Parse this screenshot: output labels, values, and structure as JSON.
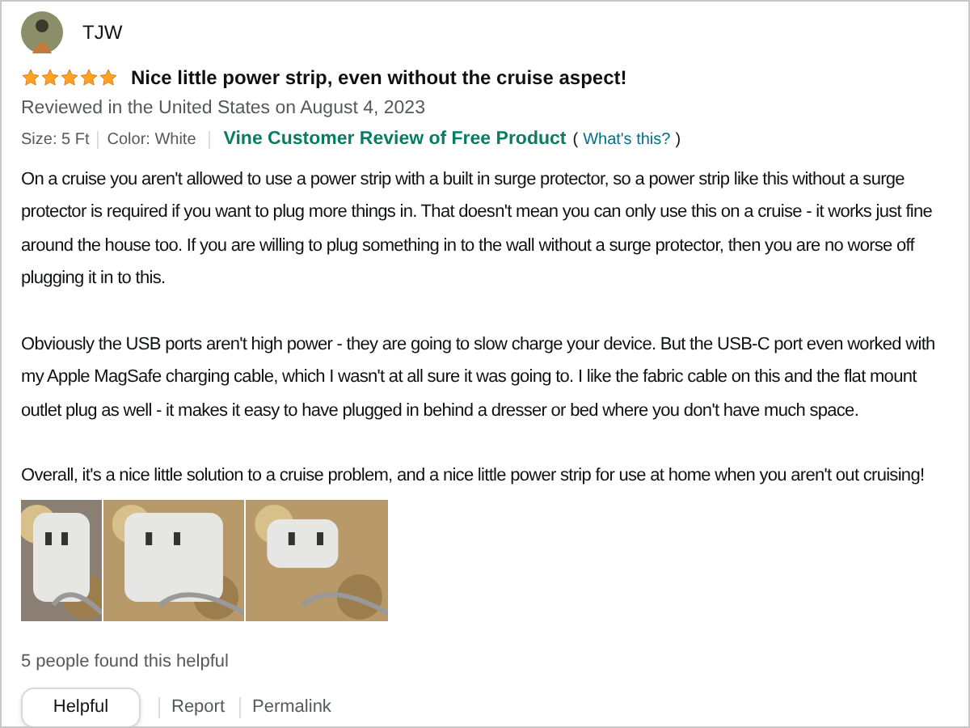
{
  "reviewer": {
    "name": "TJW"
  },
  "review": {
    "stars": 5,
    "title": "Nice little power strip, even without the cruise aspect!",
    "location_date": "Reviewed in the United States on August 4, 2023",
    "attributes": [
      "Size: 5 Ft",
      "Color: White"
    ],
    "vine_badge": "Vine Customer Review of Free Product",
    "whats_this_open": "(",
    "whats_this": "What's this?",
    "whats_this_close": ")",
    "paragraphs": [
      "On a cruise you aren't allowed to use a power strip with a built in surge protector, so a power strip like this without a surge protector is required if you want to plug more things in. That doesn't mean you can only use this on a cruise - it works just fine around the house too. If you are willing to plug something in to the wall without a surge protector, then you are no worse off plugging it in to this.",
      "Obviously the USB ports aren't high power - they are going to slow charge your device. But the USB-C port even worked with my Apple MagSafe charging cable, which I wasn't at all sure it was going to. I like the fabric cable on this and the flat mount outlet plug as well - it makes it easy to have plugged in behind a dresser or bed where you don't have much space.",
      "Overall, it's a nice little solution to a cruise problem, and a nice little power strip for use at home when you aren't out cruising!"
    ],
    "images": [
      {
        "kind": "picture"
      },
      {
        "kind": "picture"
      },
      {
        "kind": "picture"
      }
    ],
    "helpful_count": "5 people found this helpful",
    "actions": [
      "Helpful",
      "Report",
      "Permalink"
    ]
  }
}
